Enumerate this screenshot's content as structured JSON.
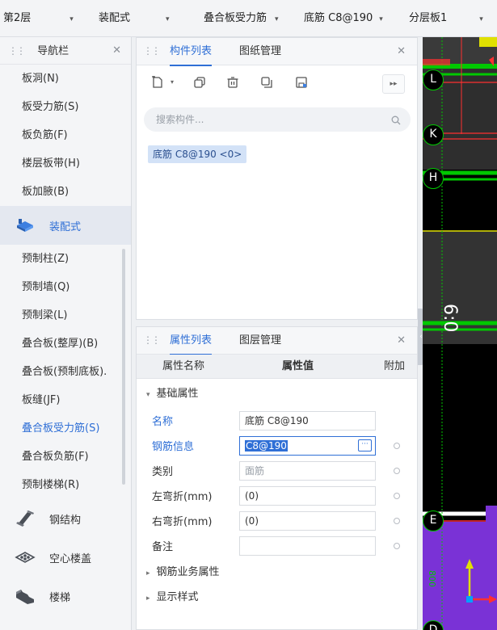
{
  "toolbar": {
    "floor": "第2层",
    "category": "装配式",
    "type": "叠合板受力筋",
    "element": "底筋 C8@190",
    "layer": "分层板1"
  },
  "nav": {
    "title": "导航栏",
    "items_top": [
      "板洞(N)",
      "板受力筋(S)",
      "板负筋(F)",
      "楼层板带(H)",
      "板加腋(B)"
    ],
    "category_prefab": "装配式",
    "items_prefab": [
      "预制柱(Z)",
      "预制墙(Q)",
      "预制梁(L)",
      "叠合板(整厚)(B)",
      "叠合板(预制底板).",
      "板缝(JF)",
      "叠合板受力筋(S)",
      "叠合板负筋(F)",
      "预制楼梯(R)"
    ],
    "categories_bottom": [
      "钢结构",
      "空心楼盖",
      "楼梯"
    ]
  },
  "component_panel": {
    "tab_list": "构件列表",
    "tab_drawing": "图纸管理",
    "search_placeholder": "搜索构件...",
    "selected_item": "底筋 C8@190 <0>"
  },
  "property_panel": {
    "tab_props": "属性列表",
    "tab_layers": "图层管理",
    "col_name": "属性名称",
    "col_value": "属性值",
    "col_extra": "附加",
    "group_basic": "基础属性",
    "rows": [
      {
        "name": "名称",
        "value": "底筋 C8@190"
      },
      {
        "name": "钢筋信息",
        "value": "C8@190"
      },
      {
        "name": "类别",
        "value": "面筋"
      },
      {
        "name": "左弯折(mm)",
        "value": "(0)"
      },
      {
        "name": "右弯折(mm)",
        "value": "(0)"
      },
      {
        "name": "备注",
        "value": ""
      }
    ],
    "group_business": "钢筋业务属性",
    "group_display": "显示样式"
  },
  "canvas": {
    "axis_labels": [
      "L",
      "K",
      "H",
      "E",
      "D"
    ],
    "dim_text": "6:0",
    "vert_text": "800"
  },
  "colors": {
    "accent": "#2f6fd6",
    "canvas_bg": "#000000",
    "rebar_green": "#00c800",
    "slab_purple": "#7a32d6",
    "slab_gray": "#3a3a3a"
  }
}
